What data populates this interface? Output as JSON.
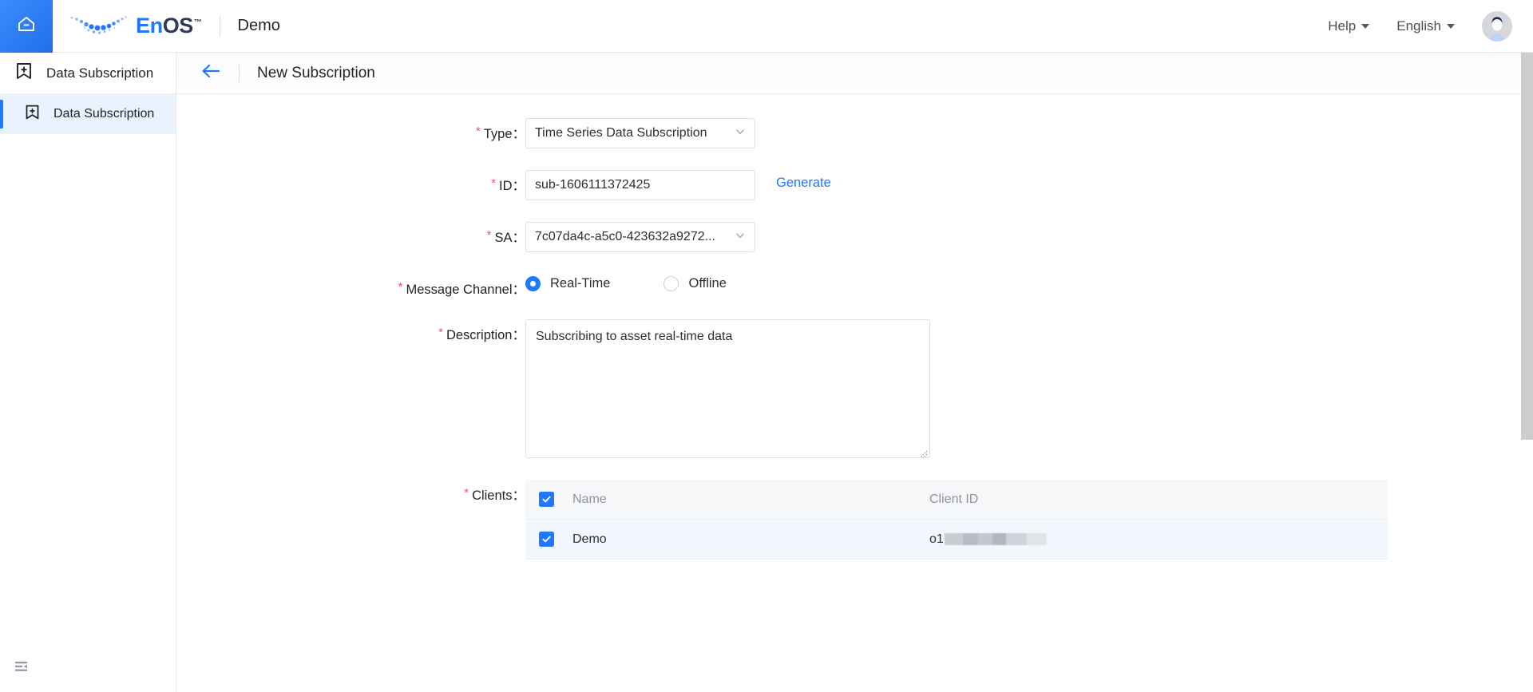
{
  "header": {
    "home_icon": "home-icon",
    "logo": {
      "brand_en": "En",
      "brand_os": "OS",
      "tm": "™"
    },
    "app_name": "Demo",
    "help_label": "Help",
    "language_label": "English",
    "avatar_icon": "user-avatar"
  },
  "sidebar": {
    "module_title": "Data Subscription",
    "items": [
      {
        "label": "Data Subscription",
        "icon": "bookmark-plus-icon",
        "active": true
      }
    ],
    "collapse_icon": "collapse-sidebar-icon"
  },
  "page": {
    "back_icon": "arrow-left-icon",
    "title": "New Subscription"
  },
  "form": {
    "type": {
      "label": "Type：",
      "required": "*",
      "value": "Time Series Data Subscription",
      "chevron_icon": "chevron-down-icon"
    },
    "id": {
      "label": "ID：",
      "required": "*",
      "value": "sub-1606111372425",
      "generate_label": "Generate"
    },
    "sa": {
      "label": "SA：",
      "required": "*",
      "value": "7c07da4c-a5c0-423632a9272...",
      "chevron_icon": "chevron-down-icon"
    },
    "message_channel": {
      "label": "Message Channel：",
      "required": "*",
      "options": [
        {
          "label": "Real-Time",
          "selected": true
        },
        {
          "label": "Offline",
          "selected": false
        }
      ]
    },
    "description": {
      "label": "Description：",
      "required": "*",
      "value": "Subscribing to asset real-time data"
    },
    "clients": {
      "label": "Clients：",
      "required": "*",
      "columns": {
        "name": "Name",
        "client_id": "Client ID"
      },
      "header_checked": true,
      "rows": [
        {
          "checked": true,
          "name": "Demo",
          "client_id_prefix": "o1",
          "client_id_redacted": true
        }
      ]
    }
  },
  "colors": {
    "accent": "#1f78ff",
    "required_red": "#f5515f",
    "sidebar_active_bg": "#eaf2fd",
    "table_header_bg": "#f6f7f9",
    "table_row_bg": "#f2f6fd"
  }
}
